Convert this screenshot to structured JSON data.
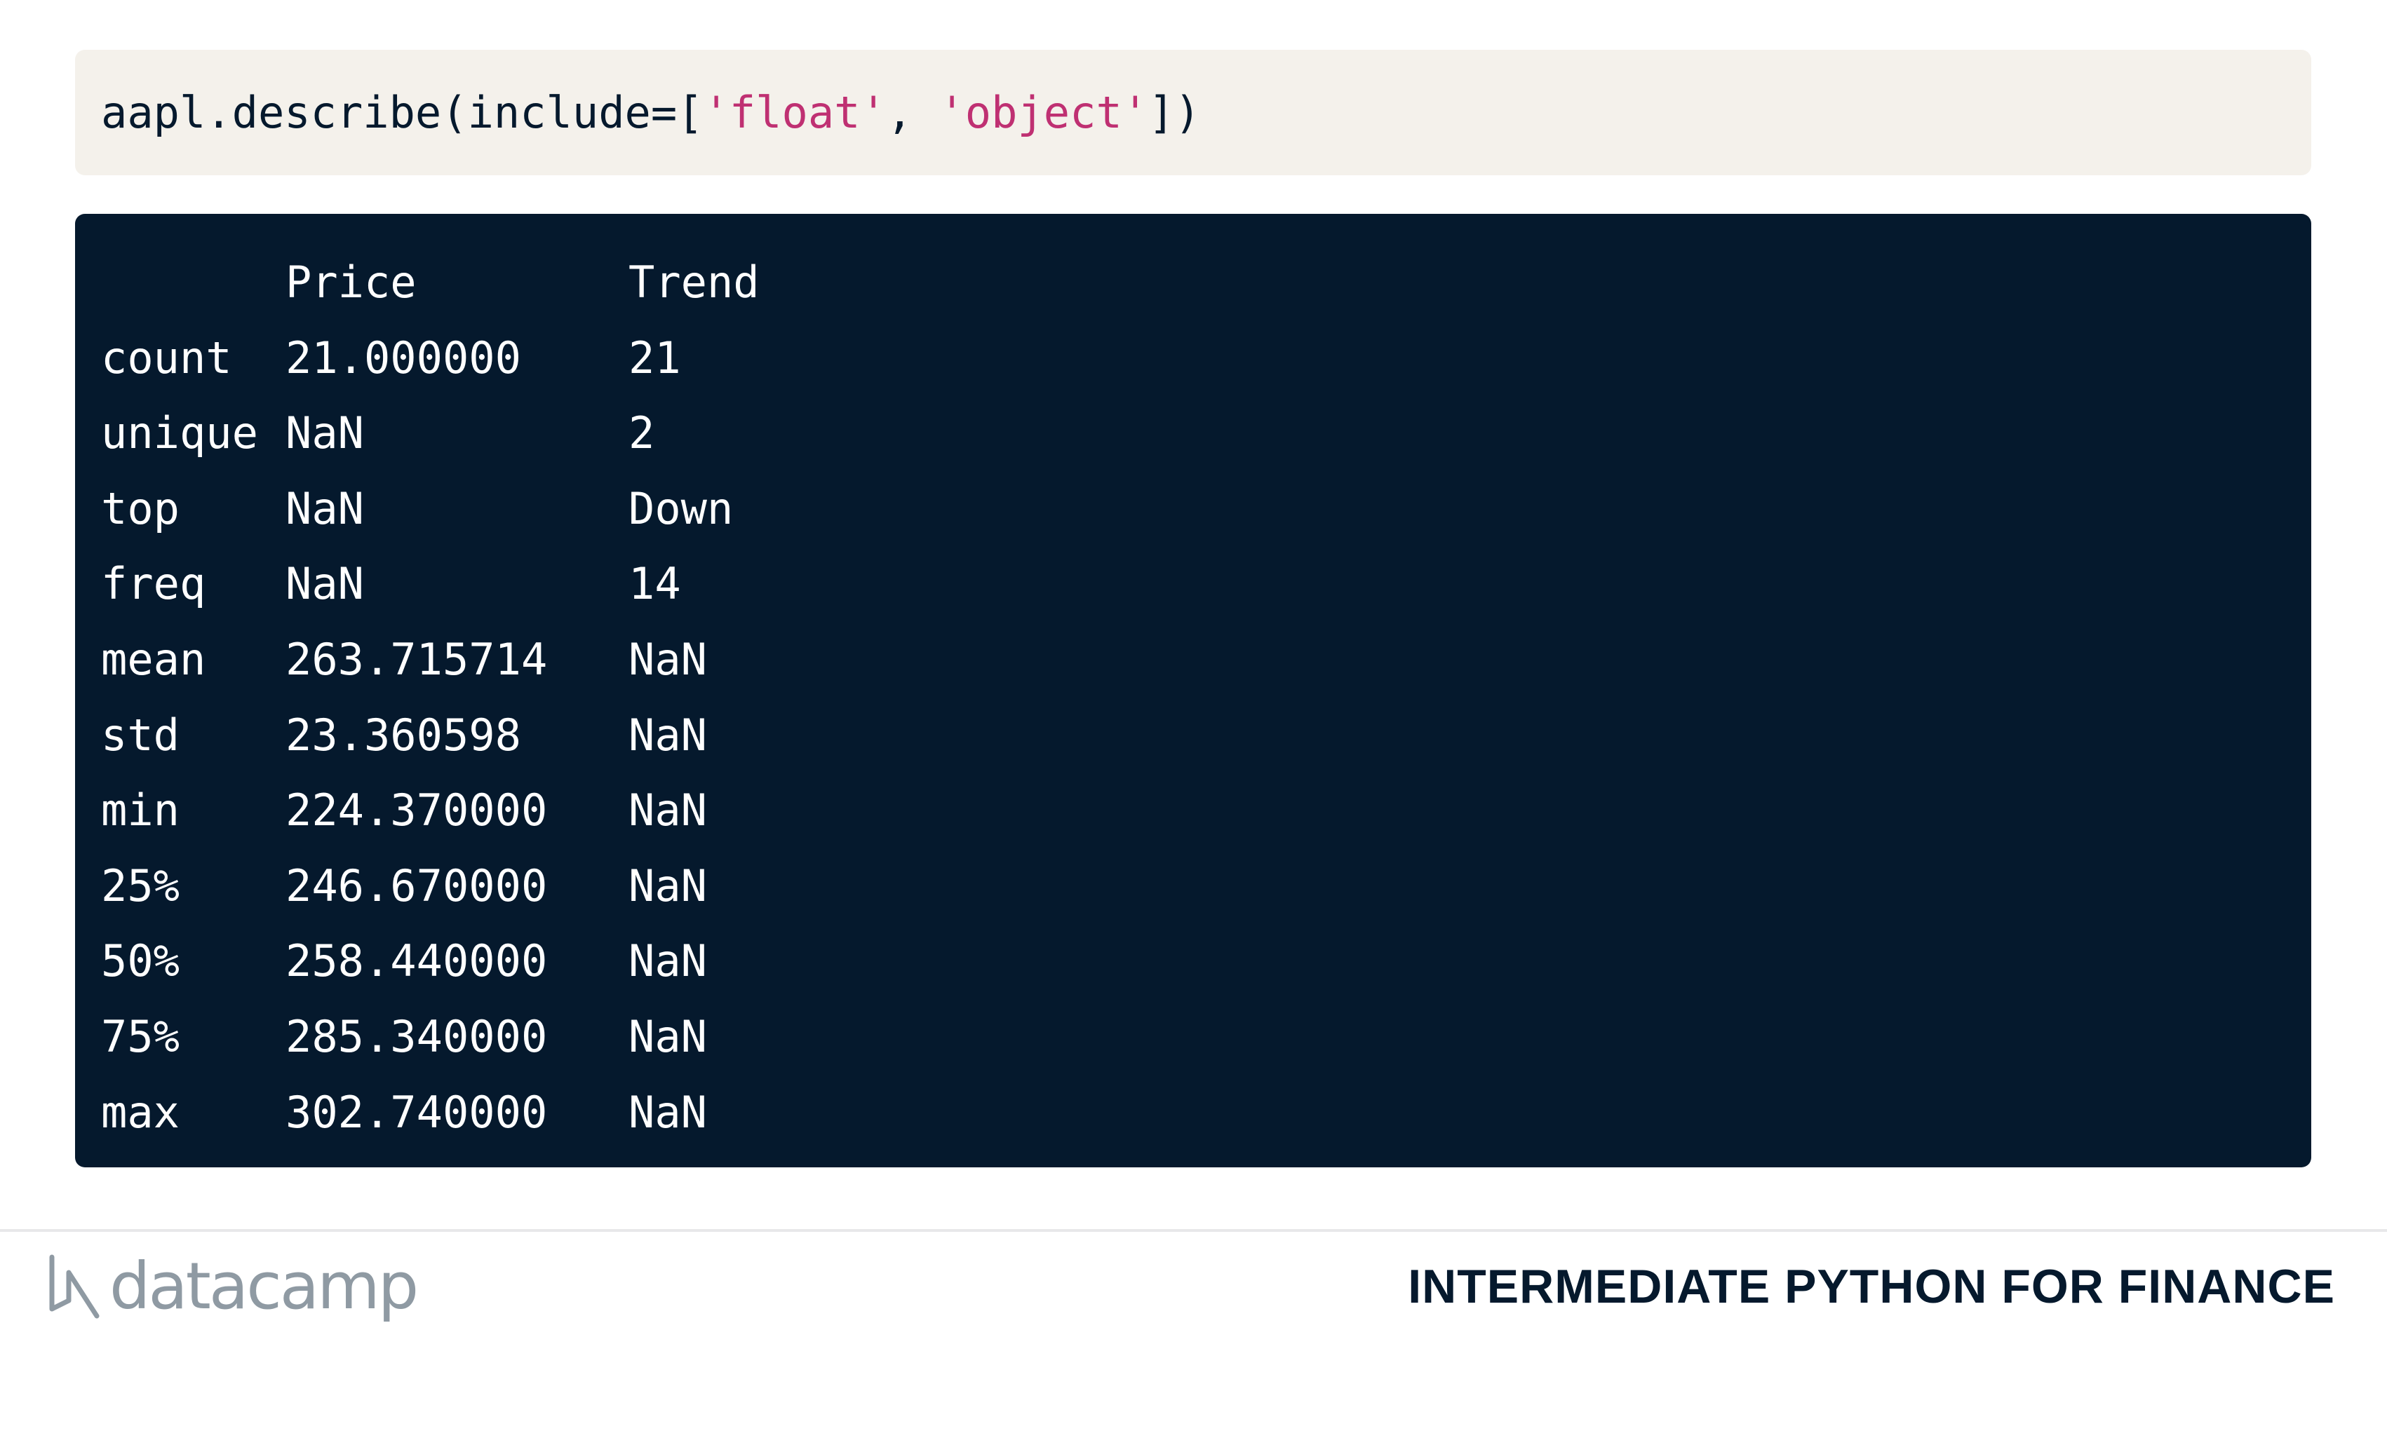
{
  "code": {
    "prefix": "aapl.describe(include=[",
    "arg1": "'float'",
    "sep": ", ",
    "arg2": "'object'",
    "suffix": "])"
  },
  "output": {
    "header": {
      "index": "",
      "price": "Price",
      "trend": "Trend"
    },
    "rows": [
      {
        "index": "count",
        "price": "21.000000",
        "trend": "21"
      },
      {
        "index": "unique",
        "price": "NaN",
        "trend": "2"
      },
      {
        "index": "top",
        "price": "NaN",
        "trend": "Down"
      },
      {
        "index": "freq",
        "price": "NaN",
        "trend": "14"
      },
      {
        "index": "mean",
        "price": "263.715714",
        "trend": "NaN"
      },
      {
        "index": "std",
        "price": "23.360598",
        "trend": "NaN"
      },
      {
        "index": "min",
        "price": "224.370000",
        "trend": "NaN"
      },
      {
        "index": "25%",
        "price": "246.670000",
        "trend": "NaN"
      },
      {
        "index": "50%",
        "price": "258.440000",
        "trend": "NaN"
      },
      {
        "index": "75%",
        "price": "285.340000",
        "trend": "NaN"
      },
      {
        "index": "max",
        "price": "302.740000",
        "trend": "NaN"
      }
    ]
  },
  "footer": {
    "logo_text": "datacamp",
    "logo_icon": "datacamp-logo-icon",
    "course_title": "INTERMEDIATE PYTHON FOR FINANCE"
  },
  "colors": {
    "code_bg": "#f4f1eb",
    "string": "#bf3072",
    "output_bg": "#05192d",
    "logo_gray": "#8f9aa3"
  }
}
